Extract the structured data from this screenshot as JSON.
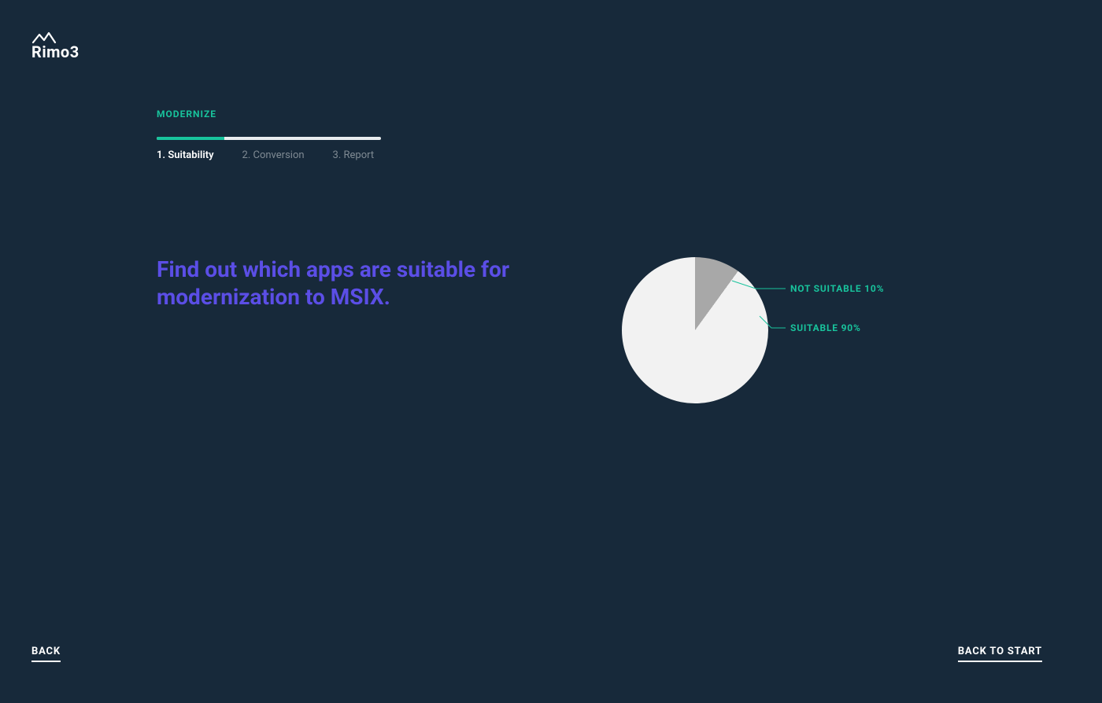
{
  "brand": {
    "name": "Rimo3"
  },
  "section": {
    "label": "MODERNIZE"
  },
  "progress": {
    "percent": 30
  },
  "steps": [
    {
      "label": "1. Suitability",
      "active": true
    },
    {
      "label": "2. Conversion",
      "active": false
    },
    {
      "label": "3. Report",
      "active": false
    }
  ],
  "headline": "Find out which apps are suitable for modernization to MSIX.",
  "chart_data": {
    "type": "pie",
    "title": "",
    "series": [
      {
        "name": "SUITABLE",
        "value": 90,
        "label": "SUITABLE 90%",
        "color": "#f2f2f2"
      },
      {
        "name": "NOT SUITABLE",
        "value": 10,
        "label": "NOT SUITABLE 10%",
        "color": "#a8a8a8"
      }
    ]
  },
  "footer": {
    "back": "BACK",
    "back_to_start": "BACK TO START"
  }
}
